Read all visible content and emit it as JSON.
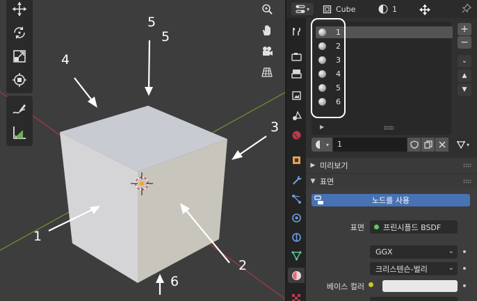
{
  "viewport": {
    "annotations": [
      "1",
      "2",
      "3",
      "4",
      "5",
      "5",
      "6"
    ],
    "tools": [
      "move-icon",
      "rotate-icon",
      "scale-icon",
      "transform-icon",
      "annotate-icon",
      "measure-icon"
    ],
    "nav": [
      "zoom-icon",
      "pan-icon",
      "camera-icon",
      "grid-icon"
    ],
    "colors": {
      "background": "#3d3d3d",
      "cube_top": "#c9cbd2",
      "cube_left": "#d5d5d7",
      "cube_right": "#c8c5bd",
      "x_axis": "#a33a44",
      "y_axis": "#6a8f2f"
    }
  },
  "header": {
    "object_name": "Cube",
    "material_slot": "1"
  },
  "tabs": [
    "tool-icon",
    "render-icon",
    "output-icon",
    "view-layer-icon",
    "scene-icon",
    "world-icon",
    "object-icon",
    "modifier-icon",
    "particles-icon",
    "physics-icon",
    "constraints-icon",
    "data-icon",
    "material-icon",
    "texture-icon"
  ],
  "slots": {
    "items": [
      "1",
      "2",
      "3",
      "4",
      "5",
      "6"
    ],
    "selected_index": 0,
    "add_label": "+",
    "remove_label": "−"
  },
  "material": {
    "name": "1"
  },
  "panels": {
    "preview_label": "미리보기",
    "surface_label": "표면"
  },
  "surface": {
    "use_nodes_label": "노드를 사용",
    "surface_label": "표면",
    "surface_value": "프린시플드 BSDF",
    "distribution_value": "GGX",
    "subsurface_value": "크리스텐슨-벌리",
    "base_color_label": "베이스 컬러",
    "base_color": "#e8e8e8"
  },
  "colors": {
    "accent": "#4772b3",
    "panel_bg": "#303030",
    "socket_green": "#63c763",
    "socket_yellow": "#c7c729"
  }
}
